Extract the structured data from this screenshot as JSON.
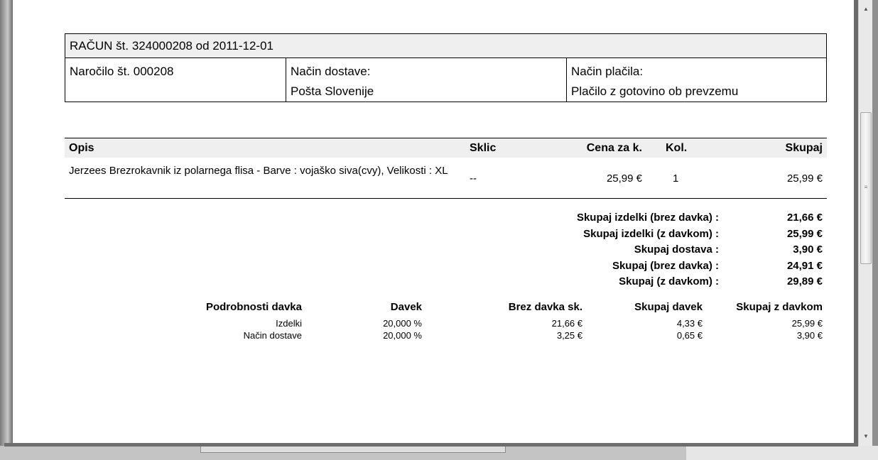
{
  "invoice": {
    "title": "RAČUN št. 324000208 od 2011-12-01",
    "order_label": "Naročilo št. 000208",
    "shipping_label": "Način dostave:",
    "shipping_value": "Pošta Slovenije",
    "payment_label": "Način plačila:",
    "payment_value": "Plačilo z gotovino ob prevzemu"
  },
  "items": {
    "headers": [
      "Opis",
      "Sklic",
      "Cena za k.",
      "Kol.",
      "Skupaj"
    ],
    "rows": [
      {
        "description": "Jerzees  Brezrokavnik iz polarnega flisa - Barve : vojaško siva(cvy), Velikosti : XL",
        "reference": "--",
        "unit_price": "25,99 €",
        "quantity": "1",
        "total": "25,99 €"
      }
    ]
  },
  "totals": [
    {
      "label": "Skupaj izdelki (brez davka) :",
      "value": "21,66 €"
    },
    {
      "label": "Skupaj izdelki (z davkom) :",
      "value": "25,99 €"
    },
    {
      "label": "Skupaj dostava :",
      "value": "3,90 €"
    },
    {
      "label": "Skupaj (brez davka) :",
      "value": "24,91 €"
    },
    {
      "label": "Skupaj (z davkom) :",
      "value": "29,89 €"
    }
  ],
  "tax_details": {
    "headers": [
      "Podrobnosti davka",
      "Davek",
      "Brez davka sk.",
      "Skupaj davek",
      "Skupaj z davkom"
    ],
    "rows": [
      [
        "Izdelki",
        "20,000 %",
        "21,66 €",
        "4,33 €",
        "25,99 €"
      ],
      [
        "Način dostave",
        "20,000 %",
        "3,25 €",
        "0,65 €",
        "3,90 €"
      ]
    ]
  },
  "scrollbar": {
    "up_icon": "triangle-up",
    "down_icon": "triangle-down",
    "grip_icon": "grip-lines"
  }
}
